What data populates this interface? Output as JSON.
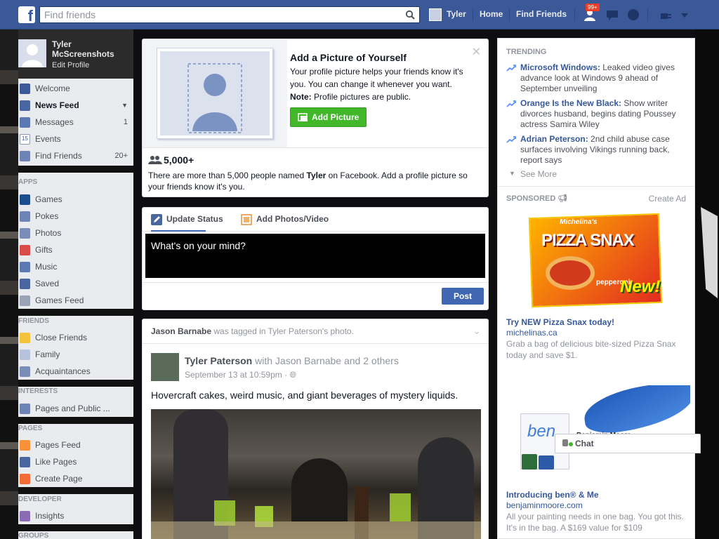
{
  "topbar": {
    "search_placeholder": "Find friends",
    "user_label": "Tyler",
    "home_label": "Home",
    "find_friends_label": "Find Friends",
    "notif_badge": "99+",
    "brand_color": "#3b5998"
  },
  "leftnav": {
    "profile_name": "Tyler McScreenshots",
    "edit_profile": "Edit Profile",
    "items": [
      {
        "label": "Welcome",
        "icon": "welcome-icon"
      },
      {
        "label": "News Feed",
        "icon": "news-feed-icon"
      },
      {
        "label": "Messages",
        "icon": "messages-icon",
        "count": "1"
      },
      {
        "label": "Events",
        "icon": "events-icon"
      },
      {
        "label": "Find Friends",
        "icon": "find-friends-icon",
        "count": "20+"
      }
    ],
    "apps_header": "APPS",
    "apps": [
      "Games",
      "Pokes",
      "Photos",
      "Gifts",
      "Music",
      "Saved",
      "Games Feed"
    ],
    "friends_header": "FRIENDS",
    "friends": [
      "Close Friends",
      "Family",
      "Acquaintances"
    ],
    "interests_header": "INTERESTS",
    "interests": [
      "Pages and Public ..."
    ],
    "pages_header": "PAGES",
    "pages": [
      "Pages Feed",
      "Like Pages",
      "Create Page"
    ],
    "developer_header": "DEVELOPER",
    "developer": [
      "Insights"
    ],
    "groups_header": "GROUPS"
  },
  "addpic": {
    "title": "Add a Picture of Yourself",
    "body": "Your profile picture helps your friends know it's you. You can change it whenever you want.",
    "note_label": "Note:",
    "note_text": "Profile pictures are public.",
    "button": "Add Picture",
    "count": "5,000+",
    "info_pre": "There are more than 5,000 people named",
    "info_name": "Tyler",
    "info_post": "on Facebook. Add a profile picture so your friends know it's you."
  },
  "composer": {
    "tab_status": "Update Status",
    "tab_photos": "Add Photos/Video",
    "placeholder": "What's on your mind?",
    "post_button": "Post"
  },
  "story": {
    "header_actor": "Jason Barnabe",
    "header_text": "was tagged in Tyler Paterson's photo.",
    "author": "Tyler Paterson",
    "with_text": "with Jason Barnabe and 2 others",
    "time": "September 13 at 10:59pm",
    "message": "Hovercraft cakes, weird music, and giant beverages of mystery liquids."
  },
  "trending": {
    "header": "TRENDING",
    "items": [
      {
        "topic": "Microsoft Windows:",
        "text": "Leaked video gives advance look at Windows 9 ahead of September unveiling"
      },
      {
        "topic": "Orange Is the New Black:",
        "text": "Show writer divorces husband, begins dating Poussey actress Samira Wiley"
      },
      {
        "topic": "Adrian Peterson:",
        "text": "2nd child abuse case surfaces involving Vikings running back, report says"
      }
    ],
    "see_more": "See More"
  },
  "sponsored": {
    "header": "SPONSORED",
    "create_ad": "Create Ad",
    "ads": [
      {
        "title": "Try NEW Pizza Snax today!",
        "url": "michelinas.ca",
        "text": "Grab a bag of delicious bite-sized Pizza Snax today and save $1.",
        "brand": "Michelina's",
        "product": "PIZZA SNAX",
        "flavor": "pepperoni",
        "tag": "New!"
      },
      {
        "title": "Introducing ben® & Me",
        "url": "benjaminmoore.com",
        "text": "All your painting needs in one bag. You got this. It's in the bag. A $169 value for $109",
        "brand": "Benjamin Moore",
        "logo_text": "ben"
      }
    ]
  },
  "chat": {
    "label": "Chat"
  }
}
